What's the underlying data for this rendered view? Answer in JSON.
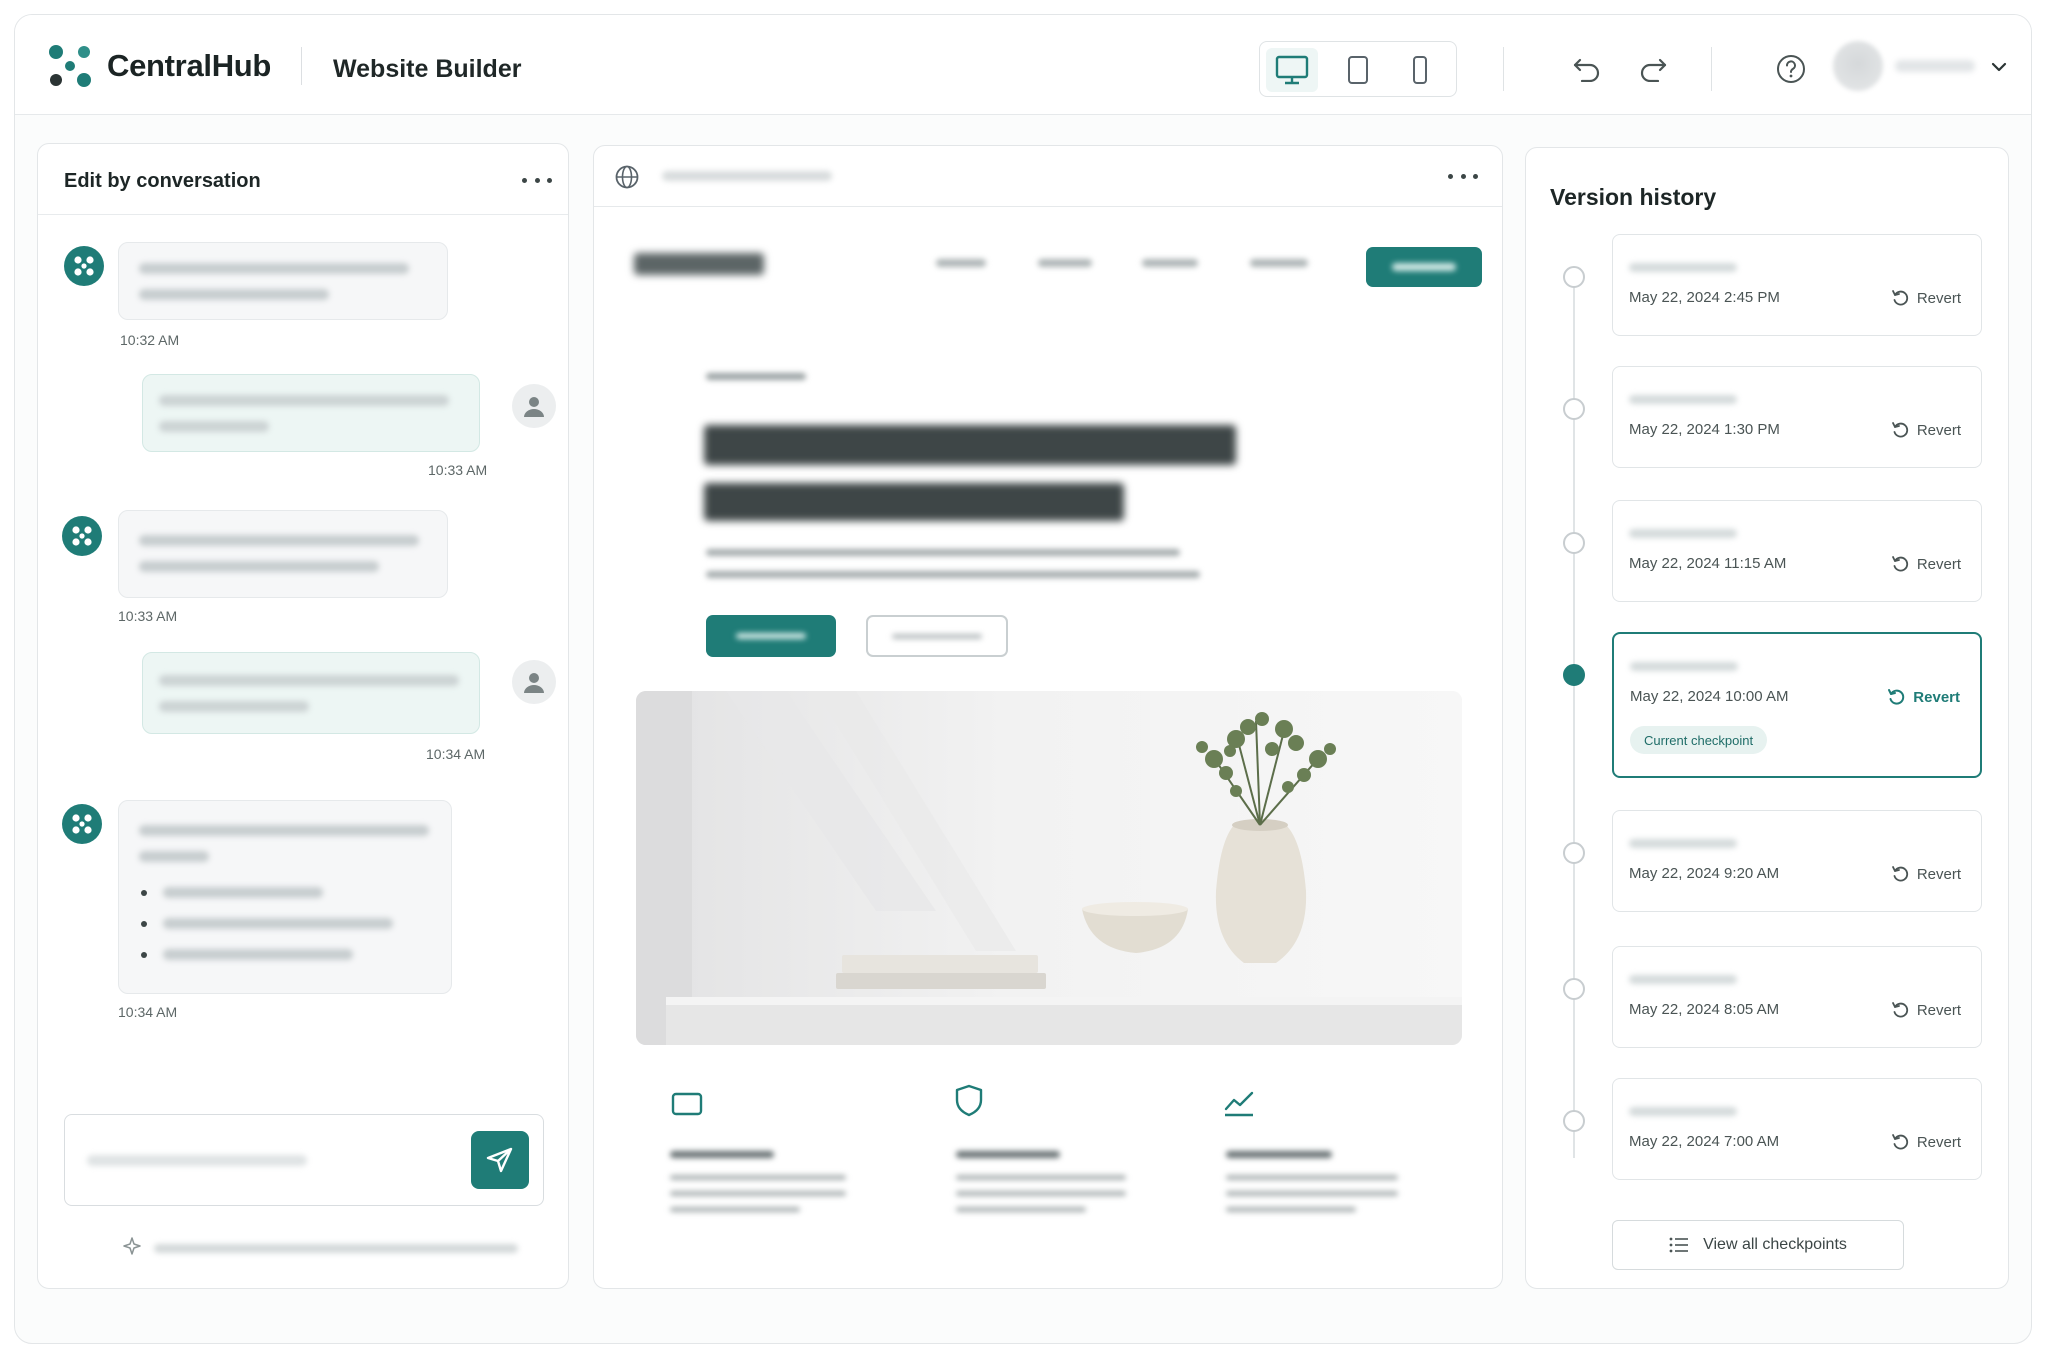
{
  "app": {
    "brand": "CentralHub",
    "product": "Website Builder",
    "device_modes": [
      {
        "name": "desktop",
        "active": true
      },
      {
        "name": "tablet",
        "active": false
      },
      {
        "name": "mobile",
        "active": false
      }
    ],
    "accent_color": "#1f7c77"
  },
  "chat": {
    "title": "Edit by conversation",
    "messages": [
      {
        "role": "assistant",
        "time": "10:32 AM"
      },
      {
        "role": "user",
        "time": "10:33 AM"
      },
      {
        "role": "assistant",
        "time": "10:33 AM"
      },
      {
        "role": "user",
        "time": "10:34 AM"
      },
      {
        "role": "assistant",
        "time": "10:34 AM"
      }
    ],
    "input": {
      "value": "",
      "send_icon": "paper-plane-icon"
    },
    "disclaimer_icon": "sparkle-icon"
  },
  "preview": {
    "menu_icon": "ellipsis-icon",
    "url_icon": "globe-icon",
    "feature_icons": [
      "tablet-icon",
      "shield-icon",
      "trend-icon"
    ]
  },
  "versions": {
    "title": "Version history",
    "revert_label": "Revert",
    "current_badge": "Current checkpoint",
    "view_all_label": "View all checkpoints",
    "items": [
      {
        "date": "May 22, 2024 2:45 PM",
        "current": false
      },
      {
        "date": "May 22, 2024 1:30 PM",
        "current": false
      },
      {
        "date": "May 22, 2024 11:15 AM",
        "current": false
      },
      {
        "date": "May 22, 2024 10:00 AM",
        "current": true
      },
      {
        "date": "May 22, 2024 9:20 AM",
        "current": false
      },
      {
        "date": "May 22, 2024 8:05 AM",
        "current": false
      },
      {
        "date": "May 22, 2024 7:00 AM",
        "current": false
      }
    ]
  }
}
